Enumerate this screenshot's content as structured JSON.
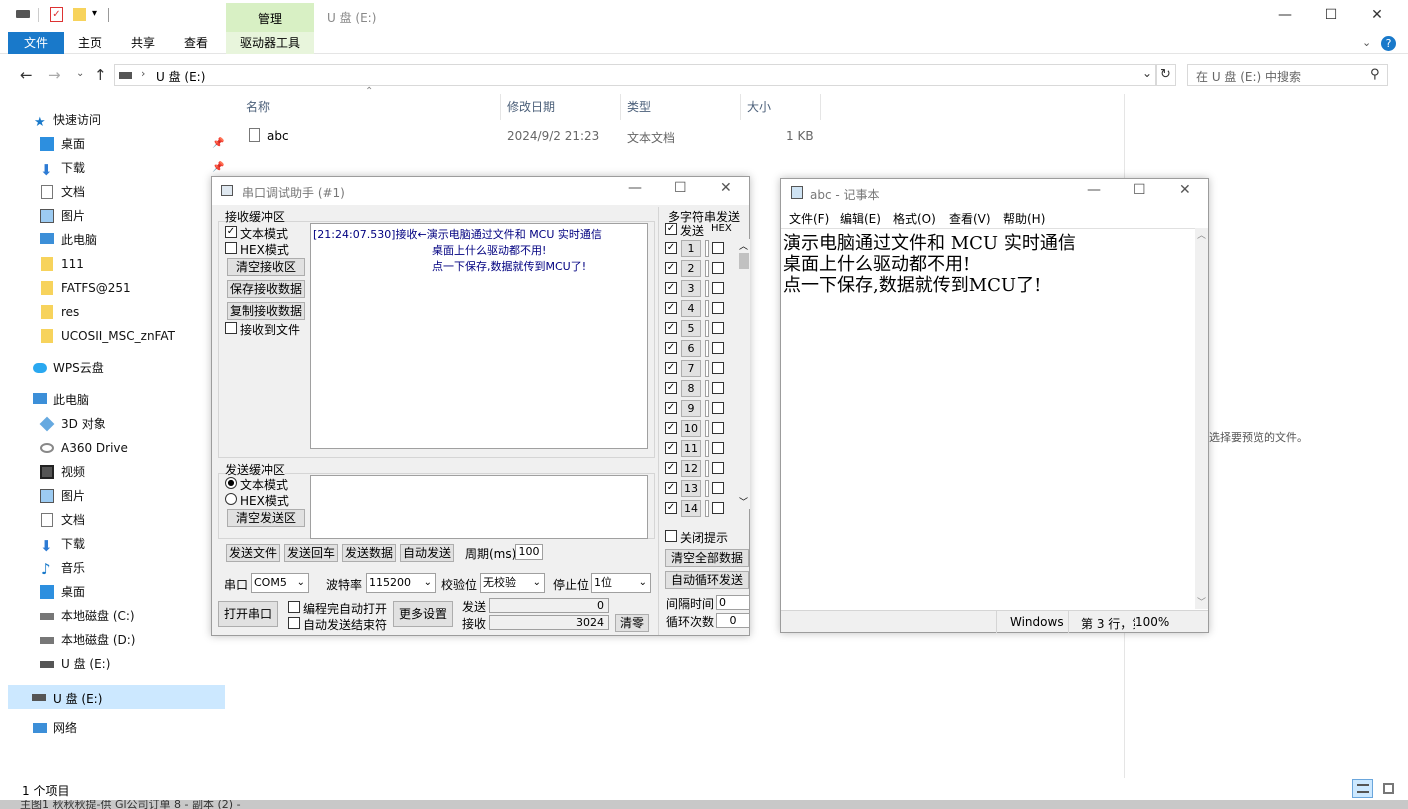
{
  "explorer": {
    "title": "U 盘 (E:)",
    "ribbon": {
      "file_tab": "文件",
      "home_tab": "主页",
      "share_tab": "共享",
      "view_tab": "查看",
      "context_group": "管理",
      "drive_tools_tab": "驱动器工具"
    },
    "address": {
      "path": "U 盘 (E:)",
      "search_placeholder": "在 U 盘 (E:) 中搜索"
    },
    "nav": {
      "quick_access": "快速访问",
      "desktop": "桌面",
      "downloads": "下载",
      "documents": "文档",
      "pictures": "图片",
      "this_pc": "此电脑",
      "folder_111": "111",
      "folder_fatfs": "FATFS@251",
      "folder_res": "res",
      "folder_ucos": "UCOSII_MSC_znFAT",
      "wps": "WPS云盘",
      "pc_section": "此电脑",
      "objects3d": "3D 对象",
      "a360": "A360 Drive",
      "videos": "视频",
      "pictures2": "图片",
      "documents2": "文档",
      "downloads2": "下载",
      "music": "音乐",
      "desktop2": "桌面",
      "disk_c": "本地磁盘 (C:)",
      "disk_d": "本地磁盘 (D:)",
      "usb_e": "U 盘 (E:)",
      "usb_e_selected": "U 盘 (E:)",
      "network": "网络"
    },
    "columns": {
      "name": "名称",
      "date": "修改日期",
      "type": "类型",
      "size": "大小"
    },
    "files": [
      {
        "name": "abc",
        "date": "2024/9/2 21:23",
        "type": "文本文档",
        "size": "1 KB"
      }
    ],
    "preview_text": "选择要预览的文件。",
    "status_count": "1 个项目",
    "bottom_strip": "主图1      秋秋秋提-供   Gl公司订单  8 - 副本 (2) -"
  },
  "serial": {
    "title": "串口调试助手 (#1)",
    "recv_group": "接收缓冲区",
    "text_mode": "文本模式",
    "hex_mode": "HEX模式",
    "clear_recv": "清空接收区",
    "save_recv": "保存接收数据",
    "copy_recv": "复制接收数据",
    "recv_to_file": "接收到文件",
    "recv_lines": [
      "[21:24:07.530]接收←演示电脑通过文件和 MCU 实时通信",
      "桌面上什么驱动都不用!",
      "点一下保存,数据就传到MCU了!"
    ],
    "send_group": "发送缓冲区",
    "send_text_mode": "文本模式",
    "send_hex_mode": "HEX模式",
    "clear_send": "清空发送区",
    "send_file": "发送文件",
    "send_cr": "发送回车",
    "send_data": "发送数据",
    "auto_send": "自动发送",
    "period_label": "周期(ms)",
    "period_value": "100",
    "port_label": "串口",
    "port_value": "COM5",
    "baud_label": "波特率",
    "baud_value": "115200",
    "parity_label": "校验位",
    "parity_value": "无校验",
    "stop_label": "停止位",
    "stop_value": "1位",
    "open_port": "打开串口",
    "auto_open": "编程完自动打开",
    "auto_terminator": "自动发送结束符",
    "more_settings": "更多设置",
    "sent_label": "发送",
    "sent_value": "0",
    "recv_label": "接收",
    "recv_value": "3024",
    "clear_counts": "清零",
    "multi_title": "多字符串发送",
    "multi_send_col": "发送",
    "multi_hex_col": "HEX",
    "multi_rows": [
      "1",
      "2",
      "3",
      "4",
      "5",
      "6",
      "7",
      "8",
      "9",
      "10",
      "11",
      "12",
      "13",
      "14"
    ],
    "close_tips": "关闭提示",
    "clear_all": "清空全部数据",
    "auto_loop": "自动循环发送",
    "interval_label": "间隔时间",
    "interval_value": "0",
    "loop_label": "循环次数",
    "loop_value": "0"
  },
  "notepad": {
    "title": "abc - 记事本",
    "menu": {
      "file": "文件(F)",
      "edit": "编辑(E)",
      "format": "格式(O)",
      "view": "查看(V)",
      "help": "帮助(H)"
    },
    "lines": [
      "演示电脑通过文件和 MCU 实时通信",
      "桌面上什么驱动都不用!",
      "点一下保存,数据就传到MCU了!"
    ],
    "status_eol": "Windows",
    "status_pos": "第 3 行，第",
    "status_zoom": "100%"
  },
  "colors": {
    "accent": "#1979ca",
    "context_tab": "#d8f0c4",
    "selection": "#cce8ff",
    "recv_text": "#000080"
  }
}
